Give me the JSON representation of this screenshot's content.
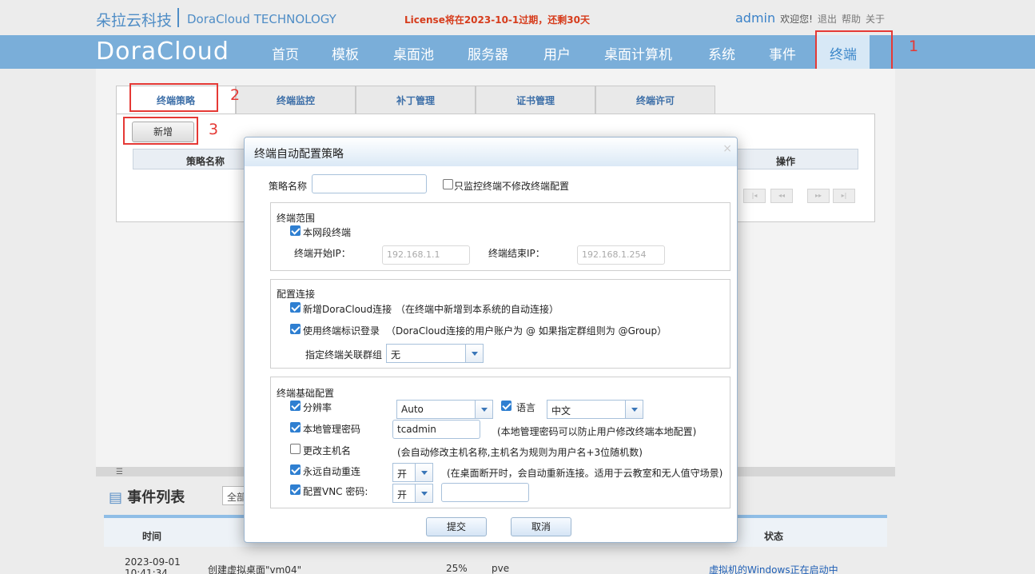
{
  "header": {
    "brand_cn": "朵拉云科技",
    "brand_en": "DoraCloud TECHNOLOGY",
    "license_notice": "License将在2023-10-1过期，还剩30天",
    "username": "admin",
    "welcome": "欢迎您!",
    "links": [
      "退出",
      "帮助",
      "关于"
    ]
  },
  "nav": {
    "logo": "DoraCloud",
    "items": [
      "首页",
      "模板",
      "桌面池",
      "服务器",
      "用户",
      "桌面计算机",
      "系统",
      "事件",
      "终端"
    ],
    "active": "终端"
  },
  "annotations": [
    "1",
    "2",
    "3"
  ],
  "tabs": [
    "终端策略",
    "终端监控",
    "补丁管理",
    "证书管理",
    "终端许可"
  ],
  "toolbar": {
    "new_label": "新增"
  },
  "grid": {
    "columns": [
      "策略名称",
      "操作"
    ]
  },
  "pager_icons": [
    "first-page-icon",
    "prev-page-icon",
    "next-page-icon",
    "last-page-icon"
  ],
  "events": {
    "title": "事件列表",
    "filter_value": "全部",
    "columns": [
      "时间",
      "状态"
    ],
    "rows": [
      {
        "time": "2023-09-01 10:41:34",
        "desc": "创建虚拟桌面\"vm04\"",
        "progress": "25%",
        "server": "pve",
        "status": "虚拟机的Windows正在启动中"
      }
    ]
  },
  "modal": {
    "title": "终端自动配置策略",
    "policy_name_label": "策略名称",
    "policy_name_value": "",
    "monitor_only_label": "只监控终端不修改终端配置",
    "monitor_only_checked": false,
    "scope": {
      "legend": "终端范围",
      "local_segment_label": "本网段终端",
      "local_segment_checked": true,
      "start_ip_label": "终端开始IP：",
      "start_ip_placeholder": "192.168.1.1",
      "end_ip_label": "终端结束IP：",
      "end_ip_placeholder": "192.168.1.254"
    },
    "connection": {
      "legend": "配置连接",
      "add_conn_label": "新增DoraCloud连接",
      "add_conn_checked": true,
      "add_conn_hint": "（在终端中新增到本系统的自动连接）",
      "use_id_label": "使用终端标识登录",
      "use_id_checked": true,
      "use_id_hint": "（DoraCloud连接的用户账户为 @ 如果指定群组则为 @Group）",
      "group_label": "指定终端关联群组",
      "group_value": "无"
    },
    "basic": {
      "legend": "终端基础配置",
      "resolution_label": "分辨率",
      "resolution_checked": true,
      "resolution_value": "Auto",
      "language_label": "语言",
      "language_checked": true,
      "language_value": "中文",
      "admin_pwd_label": "本地管理密码",
      "admin_pwd_checked": true,
      "admin_pwd_value": "tcadmin",
      "admin_pwd_hint": "(本地管理密码可以防止用户修改终端本地配置)",
      "hostname_label": "更改主机名",
      "hostname_checked": false,
      "hostname_hint": "(会自动修改主机名称,主机名为规则为用户名+3位随机数)",
      "reconnect_label": "永远自动重连",
      "reconnect_checked": true,
      "reconnect_value": "开",
      "reconnect_hint": "(在桌面断开时，会自动重新连接。适用于云教室和无人值守场景)",
      "vnc_label": "配置VNC 密码:",
      "vnc_checked": true,
      "vnc_value": "开",
      "vnc_password": ""
    },
    "submit_label": "提交",
    "cancel_label": "取消"
  },
  "colors": {
    "nav_bg": "#7aaed9",
    "accent": "#3b82c8",
    "license_red": "#d63c1c",
    "annotation_red": "#e53935",
    "checkbox_blue": "#2f7fd1"
  }
}
